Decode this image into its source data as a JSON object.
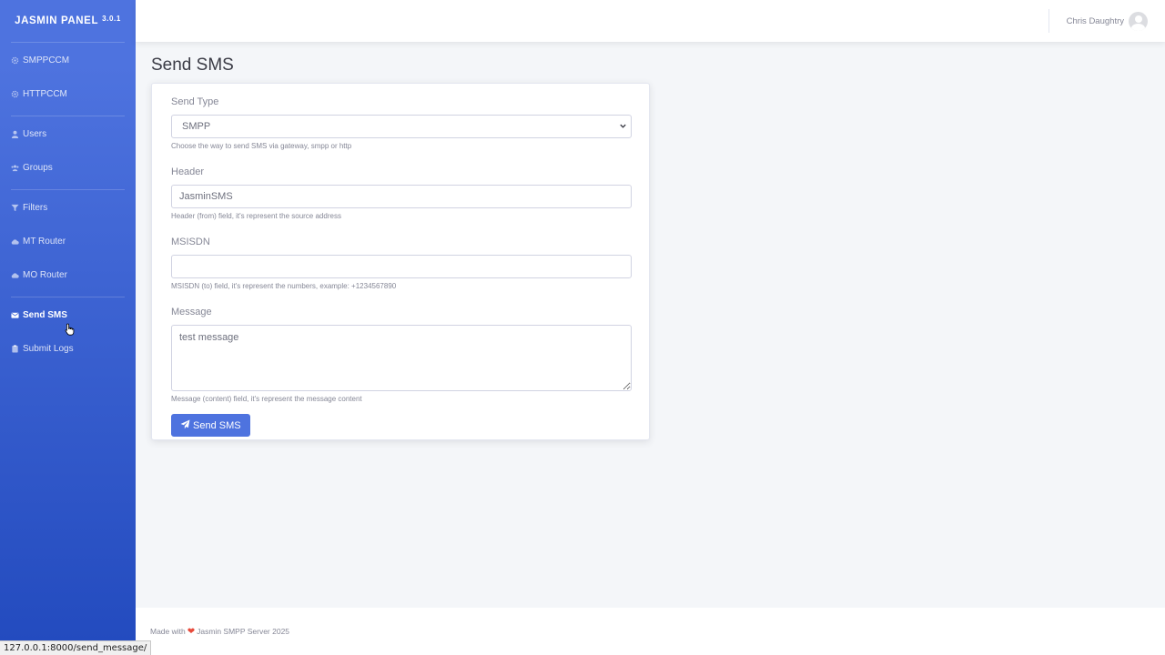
{
  "brand": {
    "name": "JASMIN PANEL",
    "version": "3.0.1"
  },
  "sidebar": {
    "groups": [
      [
        {
          "label": "SMPPCCM",
          "icon": "gear-icon"
        },
        {
          "label": "HTTPCCM",
          "icon": "gear-icon"
        }
      ],
      [
        {
          "label": "Users",
          "icon": "user-icon"
        },
        {
          "label": "Groups",
          "icon": "users-icon"
        }
      ],
      [
        {
          "label": "Filters",
          "icon": "filter-icon"
        },
        {
          "label": "MT Router",
          "icon": "cloud-upload-icon"
        },
        {
          "label": "MO Router",
          "icon": "cloud-download-icon"
        }
      ],
      [
        {
          "label": "Send SMS",
          "icon": "envelope-icon",
          "active": true
        },
        {
          "label": "Submit Logs",
          "icon": "clipboard-icon"
        }
      ]
    ]
  },
  "topbar": {
    "user_name": "Chris Daughtry"
  },
  "page": {
    "title": "Send SMS"
  },
  "form": {
    "send_type": {
      "label": "Send Type",
      "value": "SMPP",
      "help": "Choose the way to send SMS via gateway, smpp or http"
    },
    "header": {
      "label": "Header",
      "value": "JasminSMS",
      "help": "Header (from) field, it's represent the source address"
    },
    "msisdn": {
      "label": "MSISDN",
      "value": "",
      "help": "MSISDN (to) field, it's represent the numbers, example: +1234567890"
    },
    "message": {
      "label": "Message",
      "value": "test message",
      "help": "Message (content) field, it's represent the message content"
    },
    "submit_label": "Send SMS"
  },
  "footer": {
    "prefix": "Made with",
    "suffix": "Jasmin SMPP Server 2025"
  },
  "statusbar": {
    "url": "127.0.0.1:8000/send_message/"
  },
  "colors": {
    "primary": "#4e73df",
    "sidebar_bottom": "#224abe",
    "heart": "#e74a3b"
  }
}
